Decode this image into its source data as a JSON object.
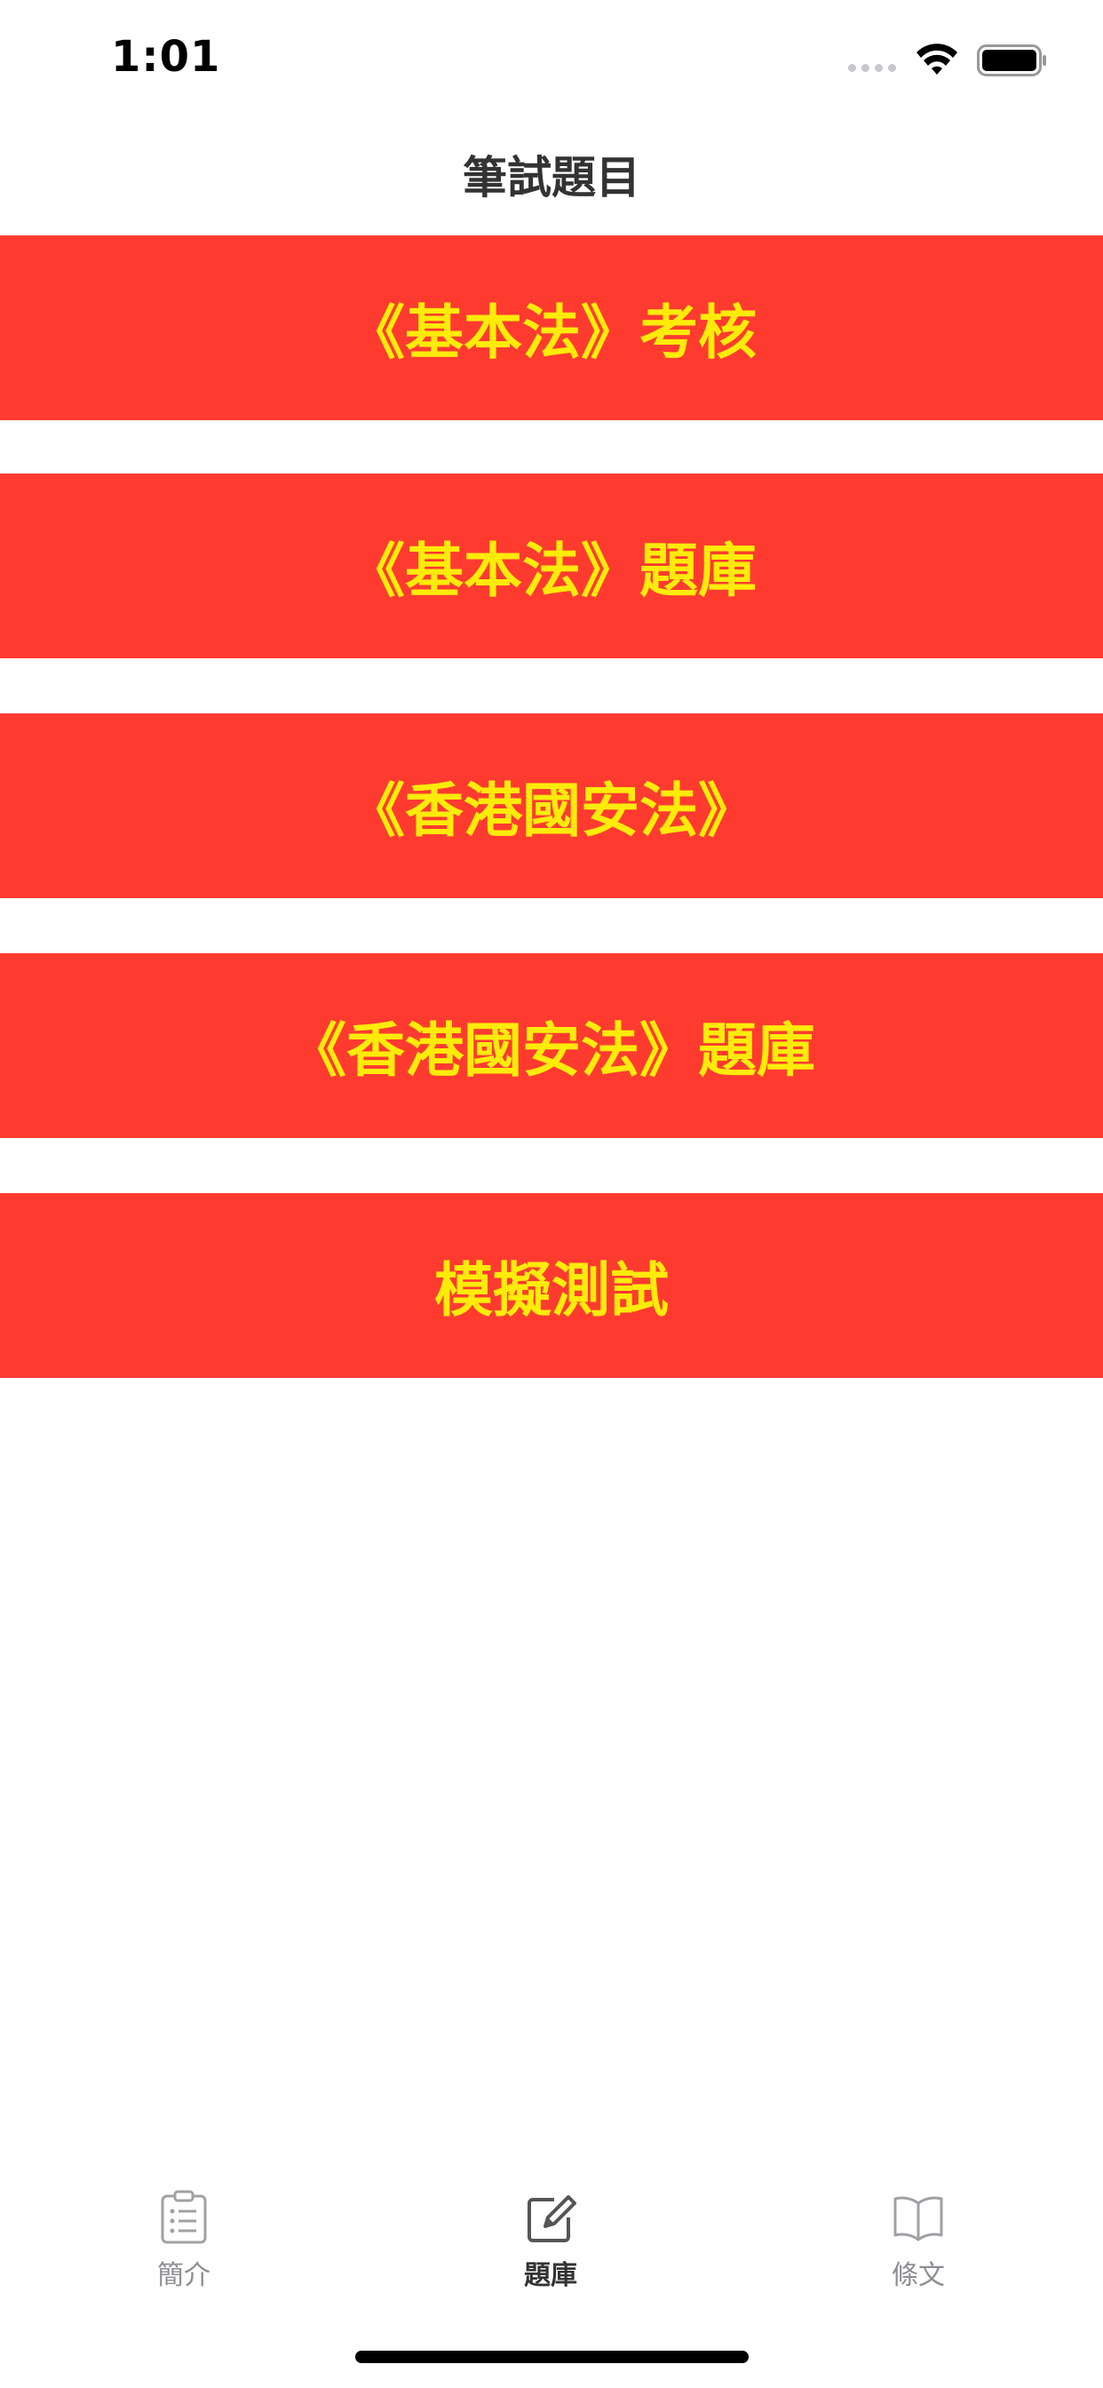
{
  "status_bar": {
    "time": "1:01"
  },
  "nav": {
    "title": "筆試題目"
  },
  "menu": {
    "items": [
      {
        "label": "《基本法》考核"
      },
      {
        "label": "《基本法》題庫"
      },
      {
        "label": "《香港國安法》"
      },
      {
        "label": "《香港國安法》題庫"
      },
      {
        "label": "模擬測試"
      }
    ]
  },
  "tab_bar": {
    "items": [
      {
        "label": "簡介",
        "icon": "clipboard-icon",
        "active": false
      },
      {
        "label": "題庫",
        "icon": "edit-icon",
        "active": true
      },
      {
        "label": "條文",
        "icon": "book-icon",
        "active": false
      }
    ]
  },
  "colors": {
    "button_background": "#ff3b30",
    "button_text": "#ffeb0a",
    "tab_active": "#333333",
    "tab_inactive": "#8e8e93"
  }
}
